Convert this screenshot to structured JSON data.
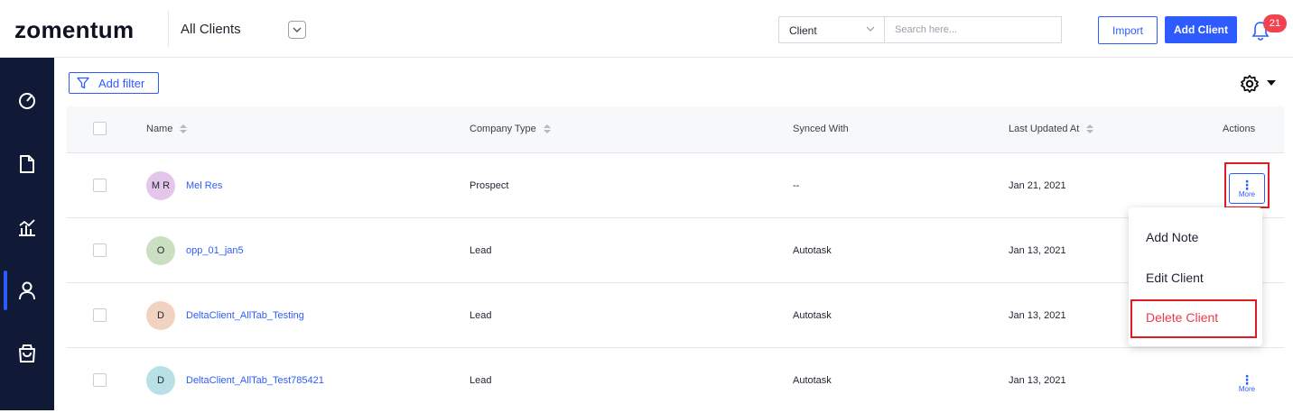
{
  "header": {
    "logo": "zomentum",
    "view_title": "All Clients",
    "search_type": "Client",
    "search_placeholder": "Search here...",
    "import_label": "Import",
    "add_client_label": "Add Client",
    "notification_count": "21"
  },
  "sidebar": {
    "items": [
      {
        "icon": "dashboard-icon",
        "active": false
      },
      {
        "icon": "document-icon",
        "active": false
      },
      {
        "icon": "chart-icon",
        "active": false
      },
      {
        "icon": "person-icon",
        "active": true
      },
      {
        "icon": "shopping-bag-icon",
        "active": false
      }
    ]
  },
  "toolbar": {
    "add_filter_label": "Add filter"
  },
  "table": {
    "columns": [
      "Name",
      "Company Type",
      "Synced With",
      "Last Updated At",
      "Actions"
    ],
    "rows": [
      {
        "initials": "M R",
        "name": "Mel Res",
        "company_type": "Prospect",
        "synced_with": "--",
        "last_updated": "Jan 21, 2021",
        "avatar_color": "#e3c6ea",
        "more_label": "More"
      },
      {
        "initials": "O",
        "name": "opp_01_jan5",
        "company_type": "Lead",
        "synced_with": "Autotask",
        "last_updated": "Jan 13, 2021",
        "avatar_color": "#cbe0c2",
        "more_label": ""
      },
      {
        "initials": "D",
        "name": "DeltaClient_AllTab_Testing",
        "company_type": "Lead",
        "synced_with": "Autotask",
        "last_updated": "Jan 13, 2021",
        "avatar_color": "#f1d3c2",
        "more_label": ""
      },
      {
        "initials": "D",
        "name": "DeltaClient_AllTab_Test785421",
        "company_type": "Lead",
        "synced_with": "Autotask",
        "last_updated": "Jan 13, 2021",
        "avatar_color": "#b9e0e6",
        "more_label": "More"
      }
    ]
  },
  "actions_menu": {
    "items": [
      "Add Note",
      "Edit Client",
      "Delete Client"
    ]
  },
  "colors": {
    "primary": "#2e5bff",
    "sidebar_bg": "#101a36",
    "danger": "#e83a4a",
    "highlight": "#e01b24"
  }
}
